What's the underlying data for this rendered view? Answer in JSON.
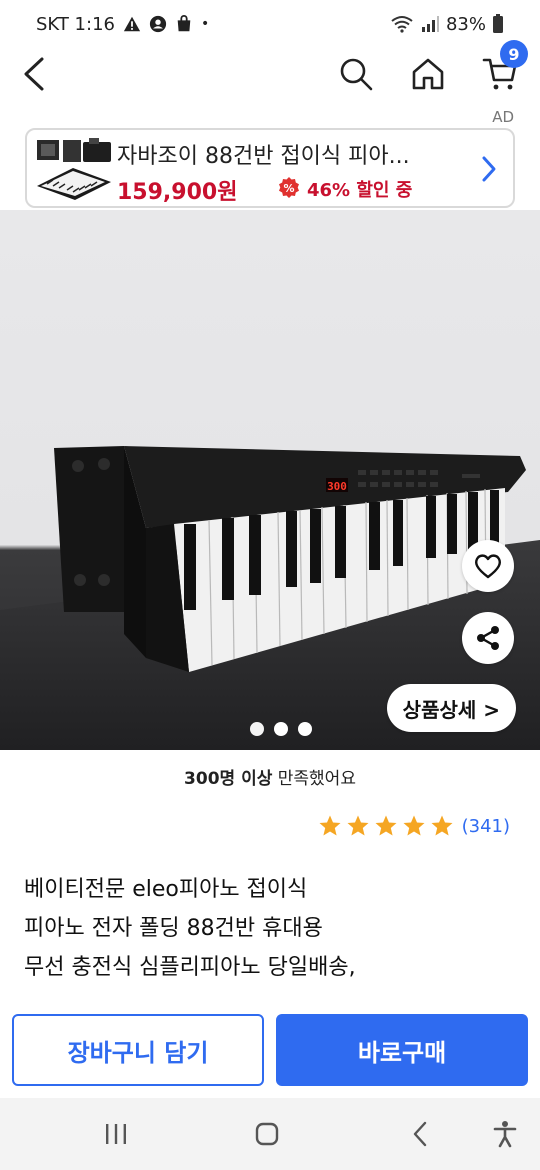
{
  "status_bar": {
    "carrier_time": "SKT 1:16",
    "dot": "•",
    "battery": "83%"
  },
  "nav": {
    "cart_badge": "9"
  },
  "ad": {
    "tag": "AD",
    "title": "자바조이 88건반 접이식 피아...",
    "price": "159,900원",
    "discount": "46% 할인 중",
    "colors": {
      "price": "#c8102e"
    }
  },
  "gallery": {
    "detail_label": "상품상세 >"
  },
  "satisfaction": {
    "count": "300명 이상",
    "suffix": " 만족했어요"
  },
  "rating": {
    "stars": 5,
    "max": 5,
    "count": "(341)"
  },
  "product": {
    "title_lines": [
      "베이티전문 eleo피아노 접이식",
      "피아노 전자 폴딩 88건반 휴대용",
      "무선 충전식 심플리피아노 당일배송,"
    ]
  },
  "buttons": {
    "cart": "장바구니 담기",
    "buy": "바로구매"
  },
  "colors": {
    "accent": "#2f6bf0"
  },
  "icons": [
    "back-arrow-icon",
    "search-icon",
    "home-icon",
    "cart-icon",
    "heart-icon",
    "share-icon",
    "chevron-right-icon",
    "star-icon",
    "recent-apps-icon",
    "home-circle-icon",
    "back-icon",
    "accessibility-icon"
  ]
}
